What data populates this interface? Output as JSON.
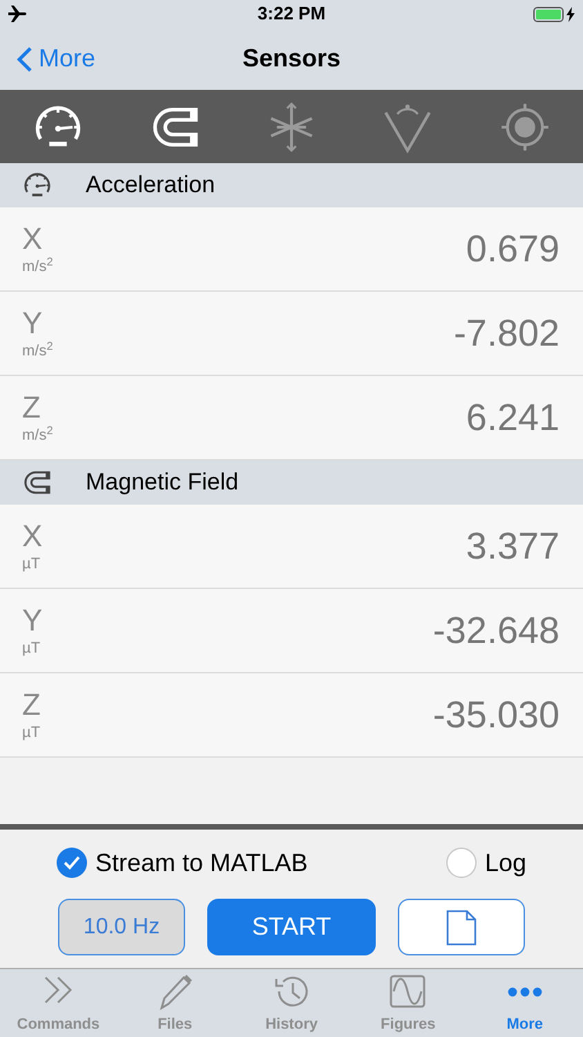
{
  "status_bar": {
    "time": "3:22 PM"
  },
  "nav": {
    "back": "More",
    "title": "Sensors"
  },
  "sensor_toolbar": [
    {
      "kind": "gauge",
      "enabled": true
    },
    {
      "kind": "magnet",
      "enabled": true
    },
    {
      "kind": "orientation",
      "enabled": false
    },
    {
      "kind": "angular",
      "enabled": false
    },
    {
      "kind": "position",
      "enabled": false
    }
  ],
  "sections": [
    {
      "kind": "gauge",
      "title": "Acceleration",
      "rows": [
        {
          "axis": "X",
          "unit": "m/s$^{2}$",
          "value": "0.679"
        },
        {
          "axis": "Y",
          "unit": "m/s$^{2}$",
          "value": "-7.802"
        },
        {
          "axis": "Z",
          "unit": "m/s$^{2}$",
          "value": "6.241"
        }
      ]
    },
    {
      "kind": "magnet",
      "title": "Magnetic Field",
      "rows": [
        {
          "axis": "X",
          "unit": "µT",
          "value": "3.377"
        },
        {
          "axis": "Y",
          "unit": "µT",
          "value": "-32.648"
        },
        {
          "axis": "Z",
          "unit": "µT",
          "value": "-35.030"
        }
      ]
    }
  ],
  "options": [
    {
      "label": "Stream to MATLAB",
      "checked": true
    },
    {
      "label": "Log",
      "checked": false
    }
  ],
  "rate_button": "10.0 Hz",
  "start_button": "START",
  "tabs": [
    {
      "kind": "commands",
      "label": "Commands",
      "selected": false
    },
    {
      "kind": "files",
      "label": "Files",
      "selected": false
    },
    {
      "kind": "history",
      "label": "History",
      "selected": false
    },
    {
      "kind": "figures",
      "label": "Figures",
      "selected": false
    },
    {
      "kind": "more",
      "label": "More",
      "selected": true
    }
  ]
}
